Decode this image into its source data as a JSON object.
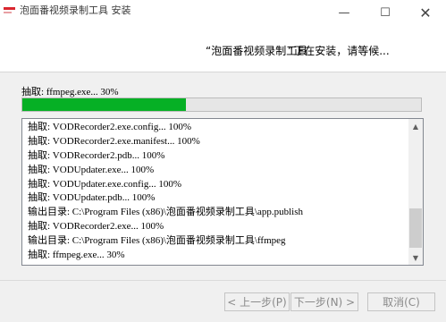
{
  "titlebar": {
    "title": "泡面番视频录制工具 安装",
    "minimize_glyph": "—",
    "maximize_glyph": "☐",
    "close_glyph": "✕"
  },
  "header": {
    "app_name": "“泡面番视频录制工具",
    "status": "”正在安装，请等候..."
  },
  "progress": {
    "status_text": "抽取: ffmpeg.exe... 30%",
    "percent": 41
  },
  "log": {
    "lines": [
      "抽取: VODRecorder2.exe.config... 100%",
      "抽取: VODRecorder2.exe.manifest... 100%",
      "抽取: VODRecorder2.pdb... 100%",
      "抽取: VODUpdater.exe... 100%",
      "抽取: VODUpdater.exe.config... 100%",
      "抽取: VODUpdater.pdb... 100%",
      "输出目录: C:\\Program Files (x86)\\泡面番视频录制工具\\app.publish",
      "抽取: VODRecorder2.exe... 100%",
      "输出目录: C:\\Program Files (x86)\\泡面番视频录制工具\\ffmpeg",
      "抽取: ffmpeg.exe... 30%"
    ]
  },
  "buttons": {
    "back": "< 上一步(P)",
    "next": "下一步(N) >",
    "cancel": "取消(C)"
  },
  "colors": {
    "progress_fill": "#06b025",
    "brand_red": "#d9262f"
  }
}
